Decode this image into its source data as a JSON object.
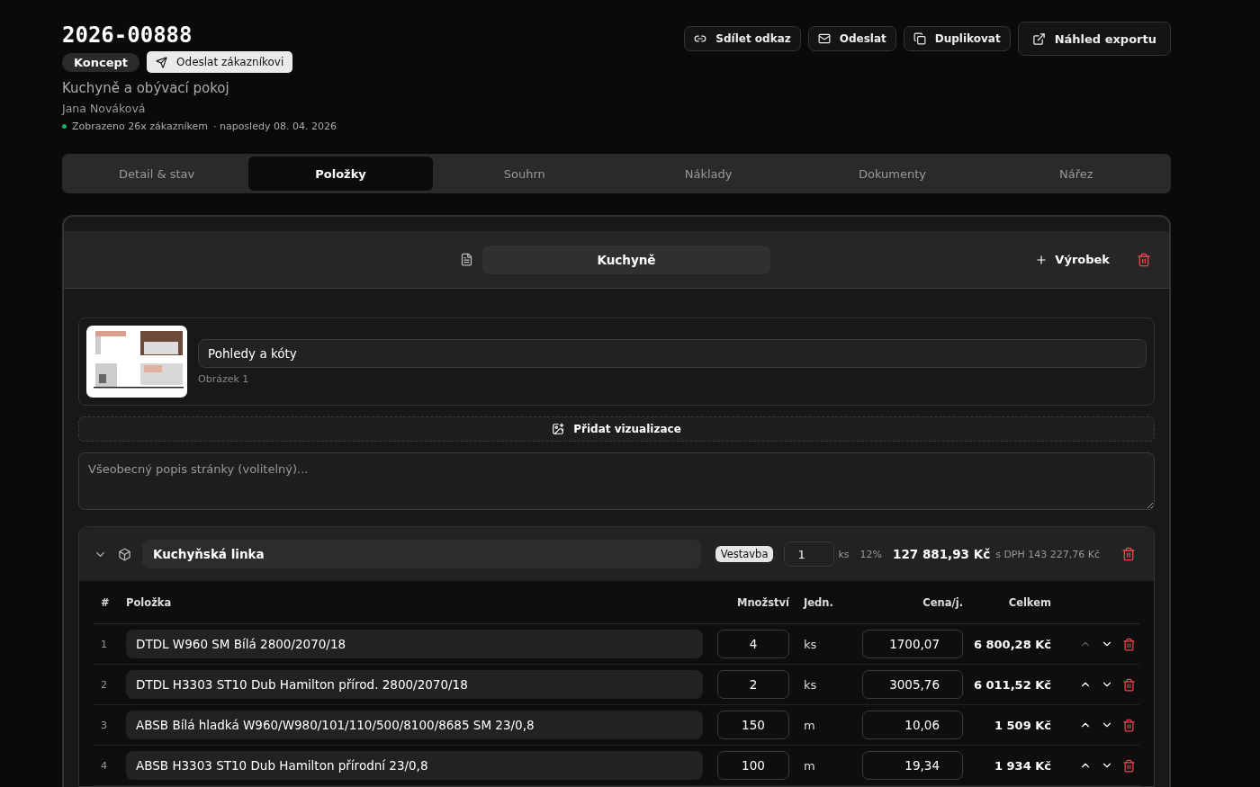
{
  "header": {
    "number": "2026-00888",
    "status": "Koncept",
    "send_button": "Odeslat zákazníkovi",
    "title": "Kuchyně a obývací pokoj",
    "customer": "Jana Nováková",
    "views": "Zobrazeno 26x zákazníkem",
    "last_seen": "· naposledy 08. 04. 2026",
    "actions": [
      {
        "kind": "link",
        "label": "Sdílet odkaz"
      },
      {
        "kind": "mail",
        "label": "Odeslat"
      },
      {
        "kind": "copy",
        "label": "Duplikovat"
      }
    ],
    "export_button": "Náhled exportu"
  },
  "tabs": [
    {
      "label": "Detail & stav",
      "selected": false
    },
    {
      "label": "Položky",
      "selected": true
    },
    {
      "label": "Souhrn",
      "selected": false
    },
    {
      "label": "Náklady",
      "selected": false
    },
    {
      "label": "Dokumenty",
      "selected": false
    },
    {
      "label": "Nářez",
      "selected": false
    }
  ],
  "section": {
    "name": "Kuchyně",
    "add_button": "Výrobek",
    "image": {
      "kind": "picture",
      "title": "Pohledy a kóty",
      "caption": "Obrázek 1"
    },
    "add_visual": "Přidat vizualizace",
    "description_placeholder": "Všeobecný popis stránky (volitelný)...",
    "product": {
      "name": "Kuchyňská linka",
      "expanded": true,
      "tag": "Vestavba",
      "quantity": "1",
      "unit": "ks",
      "vat": "12%",
      "total": "127 881,93 Kč",
      "total_vat": "s DPH 143 227,76 Kč",
      "columns": [
        "#",
        "Položka",
        "Množství",
        "Jedn.",
        "Cena/j.",
        "Celkem"
      ],
      "rows": [
        {
          "index": "1",
          "name": "DTDL W960 SM Bílá 2800/2070/18",
          "quantity": "4",
          "unit": "ks",
          "price": "1700,07",
          "total": "6 800,28 Kč",
          "can_move_up": false
        },
        {
          "index": "2",
          "name": "DTDL H3303 ST10 Dub Hamilton přírod. 2800/2070/18",
          "quantity": "2",
          "unit": "ks",
          "price": "3005,76",
          "total": "6 011,52 Kč",
          "can_move_up": true
        },
        {
          "index": "3",
          "name": "ABSB Bílá hladká W960/W980/101/110/500/8100/8685 SM 23/0,8",
          "quantity": "150",
          "unit": "m",
          "price": "10,06",
          "total": "1 509 Kč",
          "can_move_up": true
        },
        {
          "index": "4",
          "name": "ABSB H3303 ST10 Dub Hamilton přírodní 23/0,8",
          "quantity": "100",
          "unit": "m",
          "price": "19,34",
          "total": "1 934 Kč",
          "can_move_up": true
        }
      ]
    }
  }
}
